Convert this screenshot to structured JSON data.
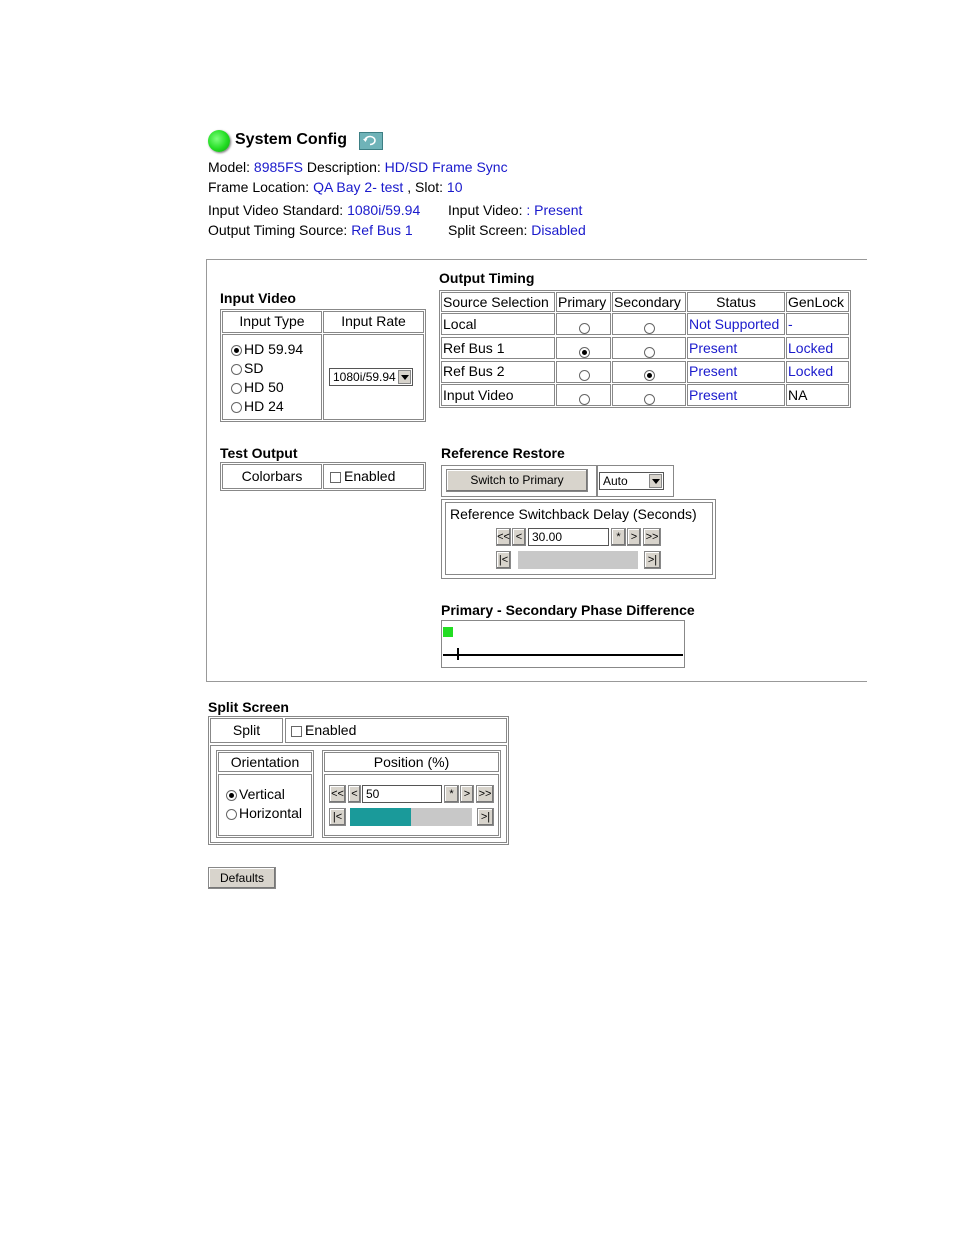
{
  "header": {
    "title": "System Config",
    "model_label": "Model:",
    "model_value": "8985FS",
    "description_label": "Description:",
    "description_value": "HD/SD Frame Sync",
    "frame_location_label": "Frame Location:",
    "frame_location_value": "QA Bay 2- test",
    "slot_label": ", Slot:",
    "slot_value": "10",
    "input_video_standard_label": "Input Video Standard:",
    "input_video_standard_value": "1080i/59.94",
    "input_video_label": "Input Video:",
    "input_video_value": ": Present",
    "output_timing_source_label": "Output Timing Source:",
    "output_timing_source_value": "Ref Bus 1",
    "split_screen_label": "Split Screen:",
    "split_screen_value": "Disabled",
    "status_color": "#22dd22"
  },
  "input_video": {
    "title": "Input Video",
    "col_input_type": "Input Type",
    "col_input_rate": "Input Rate",
    "types": [
      {
        "label": "HD 59.94",
        "selected": true
      },
      {
        "label": "SD",
        "selected": false
      },
      {
        "label": "HD 50",
        "selected": false
      },
      {
        "label": "HD 24",
        "selected": false
      }
    ],
    "rate_value": "1080i/59.94"
  },
  "test_output": {
    "title": "Test Output",
    "label": "Colorbars",
    "enabled_label": "Enabled",
    "enabled": false
  },
  "output_timing": {
    "title": "Output Timing",
    "headers": [
      "Source Selection",
      "Primary",
      "Secondary",
      "Status",
      "GenLock"
    ],
    "rows": [
      {
        "source": "Local",
        "primary": false,
        "secondary": false,
        "status": "Not Supported",
        "genlock": "-"
      },
      {
        "source": "Ref Bus 1",
        "primary": true,
        "secondary": false,
        "status": "Present",
        "genlock": "Locked"
      },
      {
        "source": "Ref Bus 2",
        "primary": false,
        "secondary": true,
        "status": "Present",
        "genlock": "Locked"
      },
      {
        "source": "Input Video",
        "primary": false,
        "secondary": false,
        "status": "Present",
        "genlock": "NA"
      }
    ]
  },
  "reference_restore": {
    "title": "Reference Restore",
    "switch_button": "Switch to Primary",
    "mode_value": "Auto",
    "delay_label": "Reference Switchback Delay (Seconds)",
    "delay_value": "30.00",
    "btn_fast_back": "<<",
    "btn_back": "<",
    "btn_star": "*",
    "btn_fwd": ">",
    "btn_fast_fwd": ">>",
    "btn_min": "|<",
    "btn_max": ">|"
  },
  "phase_difference": {
    "title": "Primary - Secondary Phase Difference",
    "indicator_color": "#22dd22"
  },
  "split_screen": {
    "title": "Split Screen",
    "split_label": "Split",
    "enabled_label": "Enabled",
    "enabled": false,
    "orientation_label": "Orientation",
    "orientations": [
      {
        "label": "Vertical",
        "selected": true
      },
      {
        "label": "Horizontal",
        "selected": false
      }
    ],
    "position_label": "Position (%)",
    "position_value": "50",
    "position_fraction": 0.5,
    "btn_fast_back": "<<",
    "btn_back": "<",
    "btn_star": "*",
    "btn_fwd": ">",
    "btn_fast_fwd": ">>",
    "btn_min": "|<",
    "btn_max": ">|"
  },
  "defaults_button": "Defaults"
}
